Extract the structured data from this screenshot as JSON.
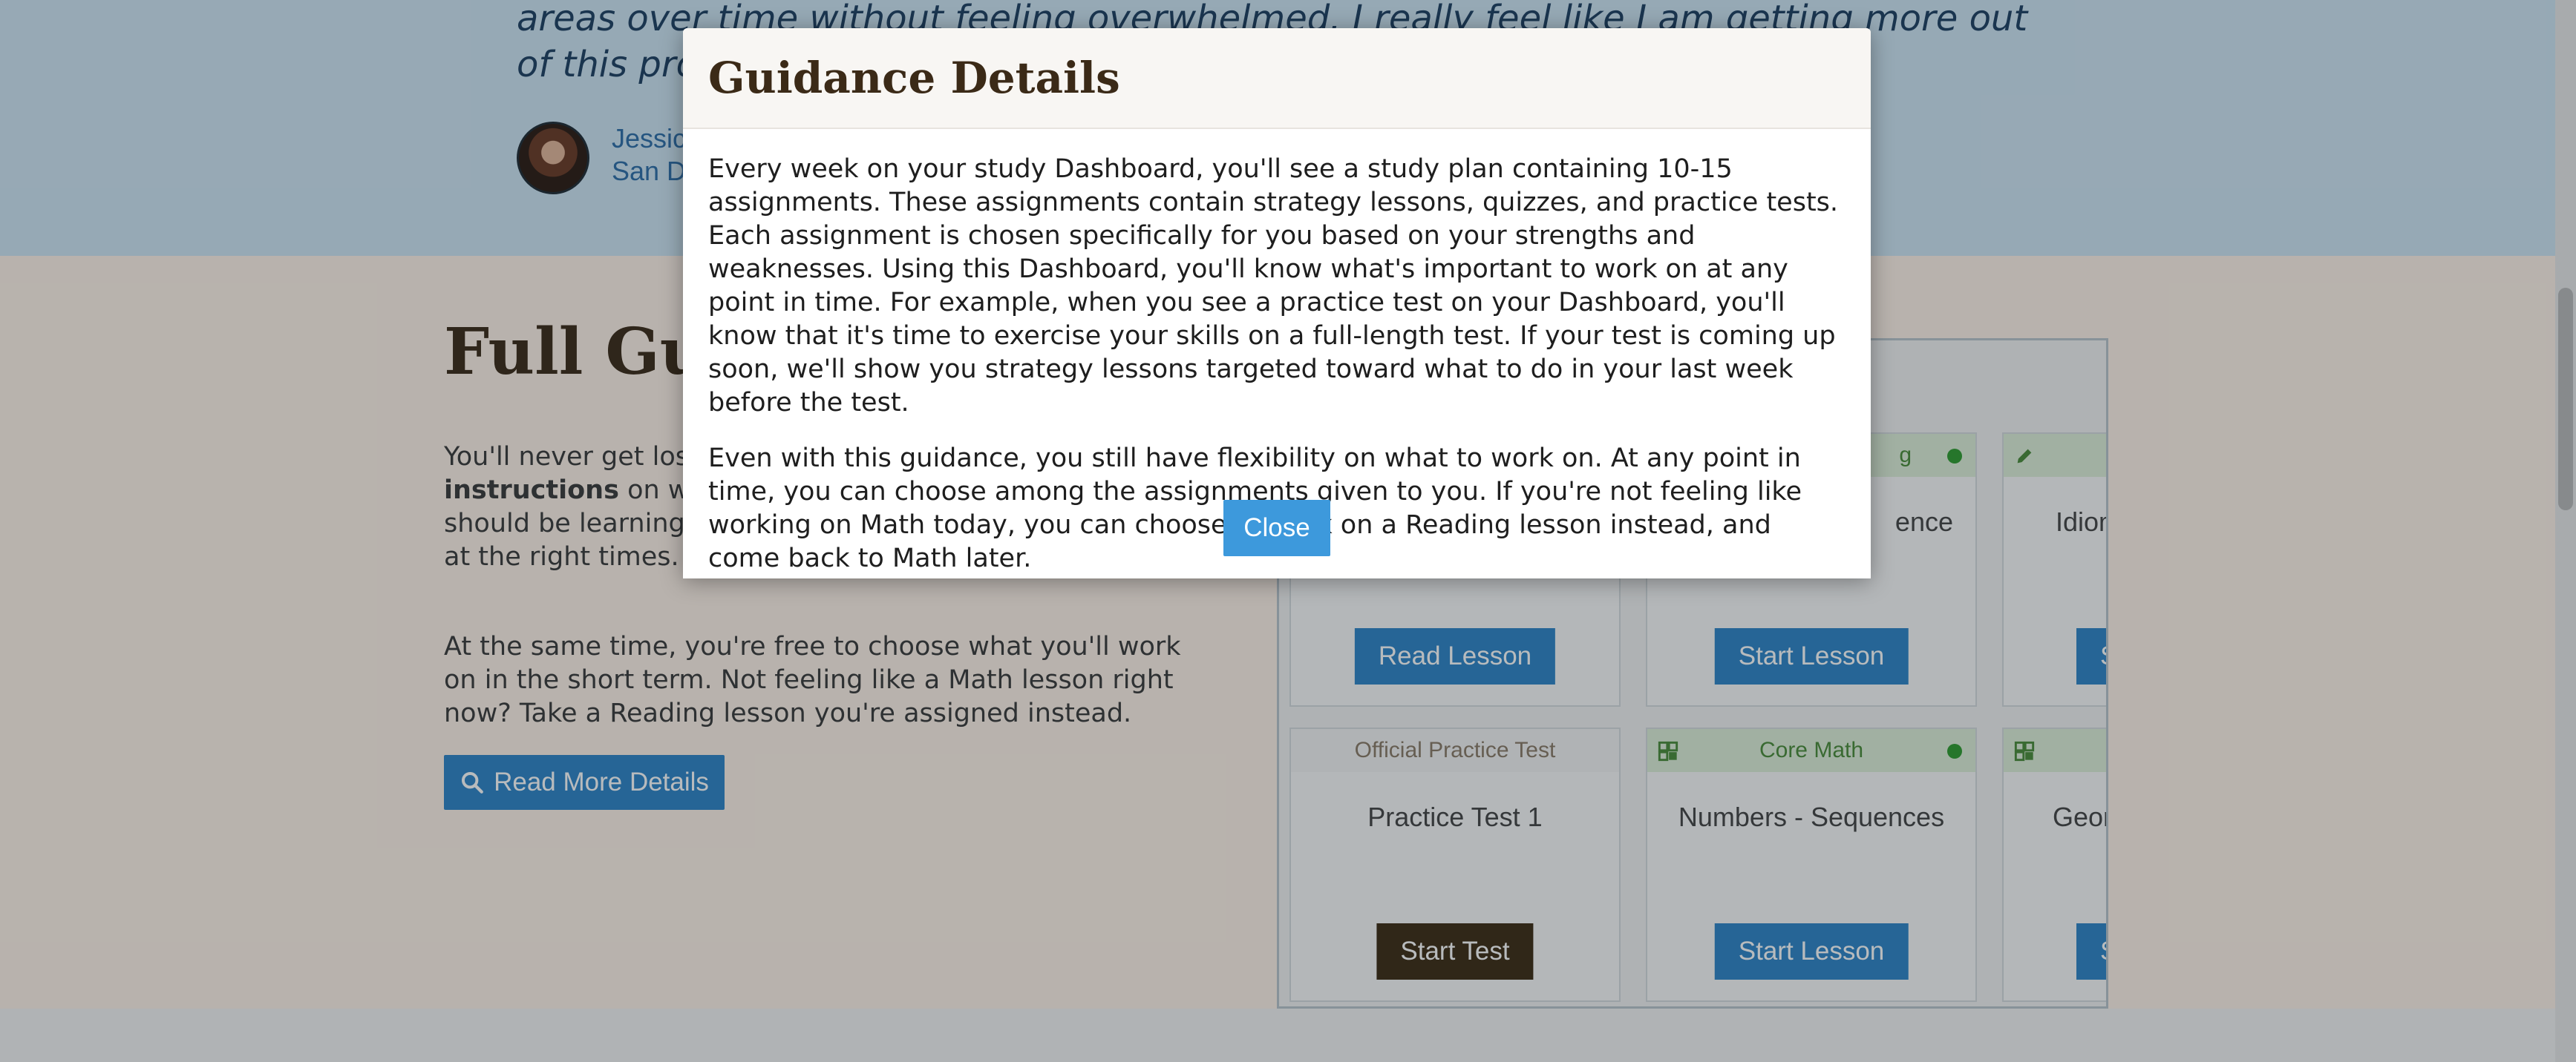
{
  "testimonial": {
    "quote": "areas over time without feeling overwhelmed. I really feel like I am getting more out of this program than I did with private tutors.",
    "author_name": "Jessica",
    "author_location": "San Di"
  },
  "section": {
    "heading": "Full Guidance",
    "paragraph1_start": "You'll never get lost o",
    "paragraph1_bold": "instructions",
    "paragraph1_rest": " on what to do next. We tell you whether you should be learning, practicing, or reviewing your mistakes at the right times.",
    "paragraph2": "At the same time, you're free to choose what you'll work on in the short term. Not feeling like a Math lesson right now? Take a Reading lesson you're assigned instead.",
    "read_more_label": "Read More Details"
  },
  "dashboard": {
    "cards": [
      {
        "header": "",
        "title": "",
        "button": "Read Lesson"
      },
      {
        "header": "g",
        "title": "ence",
        "button": "Start Lesson"
      },
      {
        "header": "",
        "title": "Idiom",
        "button": "S"
      },
      {
        "header": "Official Practice Test",
        "title": "Practice Test 1",
        "button": "Start Test"
      },
      {
        "header": "Core Math",
        "title": "Numbers - Sequences",
        "button": "Start Lesson"
      },
      {
        "header": "",
        "title": "Geom",
        "button": "S"
      }
    ]
  },
  "modal": {
    "title": "Guidance Details",
    "paragraph1": "Every week on your study Dashboard, you'll see a study plan containing 10-15 assignments. These assignments contain strategy lessons, quizzes, and practice tests. Each assignment is chosen specifically for you based on your strengths and weaknesses. Using this Dashboard, you'll know what's important to work on at any point in time. For example, when you see a practice test on your Dashboard, you'll know that it's time to exercise your skills on a full-length test. If your test is coming up soon, we'll show you strategy lessons targeted toward what to do in your last week before the test.",
    "paragraph2": "Even with this guidance, you still have flexibility on what to work on. At any point in time, you can choose among the assignments given to you. If you're not feeling like working on Math today, you can choose to work on a Reading lesson instead, and come back to Math later.",
    "close_label": "Close"
  },
  "colors": {
    "accent_blue": "#2f85c7",
    "close_blue": "#3d99dc",
    "heading_brown": "#3b2a17",
    "card_green": "#dff0d8"
  }
}
